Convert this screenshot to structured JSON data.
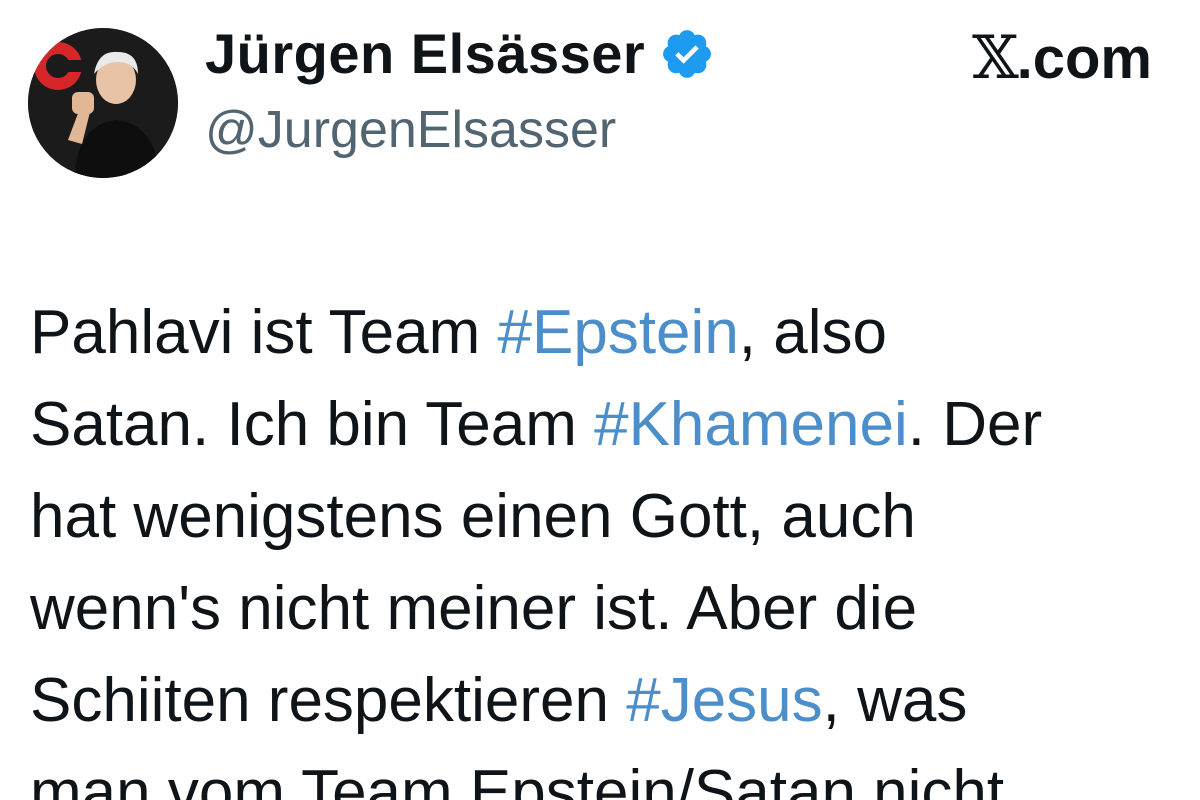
{
  "author": {
    "display_name": "Jürgen Elsässer",
    "handle": "@JurgenElsasser",
    "verified": true,
    "avatar_icon": "profile-photo-raised-fist"
  },
  "source": {
    "label": ".com",
    "logo": "x-logo"
  },
  "tweet": {
    "lines": [
      [
        {
          "text": "Pahlavi ist Team ",
          "type": "text"
        },
        {
          "text": "#Epstein",
          "type": "hashtag"
        },
        {
          "text": ", also",
          "type": "text"
        }
      ],
      [
        {
          "text": "Satan. Ich bin Team ",
          "type": "text"
        },
        {
          "text": "#Khamenei",
          "type": "hashtag"
        },
        {
          "text": ". Der",
          "type": "text"
        }
      ],
      [
        {
          "text": "hat wenigstens einen Gott, auch",
          "type": "text"
        }
      ],
      [
        {
          "text": "wenn's nicht meiner ist. Aber die",
          "type": "text"
        }
      ],
      [
        {
          "text": "Schiiten respektieren ",
          "type": "text"
        },
        {
          "text": "#Jesus",
          "type": "hashtag"
        },
        {
          "text": ", was",
          "type": "text"
        }
      ],
      [
        {
          "text": "man vom Team Epstein/Satan nicht",
          "type": "text"
        }
      ]
    ]
  },
  "colors": {
    "hashtag": "#4b8ec9",
    "handle": "#536471",
    "verified": "#1d9bf0",
    "text": "#0f1419"
  }
}
